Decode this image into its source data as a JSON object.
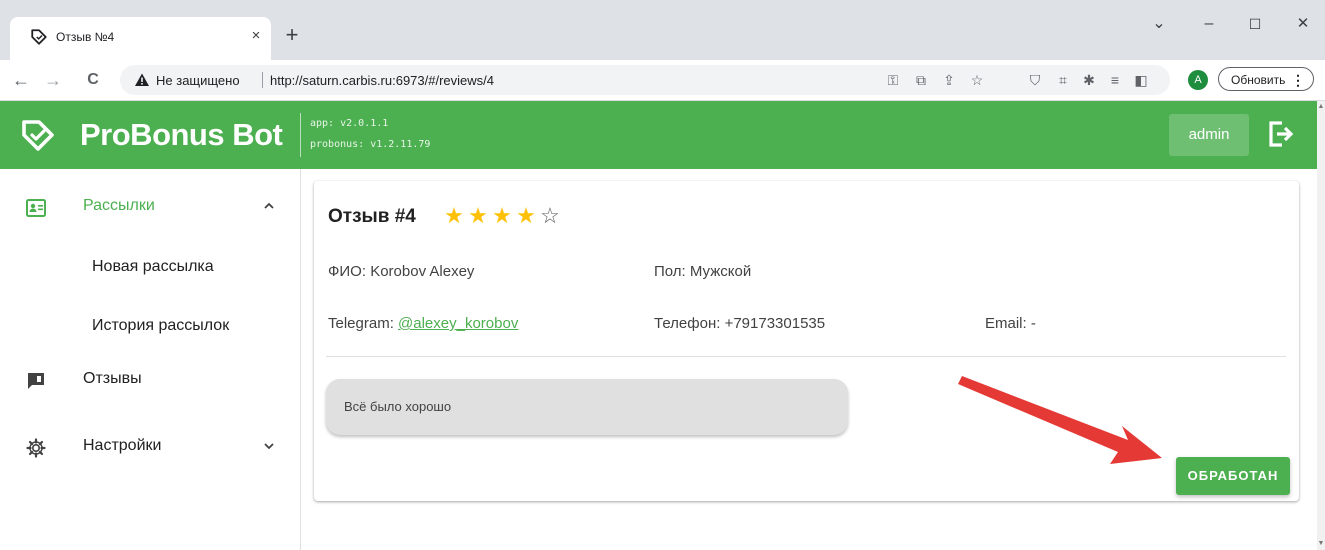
{
  "browser": {
    "tab_title": "Отзыв №4",
    "tab_close": "×",
    "new_tab": "+",
    "window": {
      "minimize": "–",
      "maximize": "☐",
      "close": "✕",
      "dropdown": "⌄"
    },
    "nav": {
      "back": "←",
      "forward": "→",
      "reload": "C"
    },
    "security_label": "Не защищено",
    "url": "http://saturn.carbis.ru:6973/#/reviews/4",
    "update_label": "Обновить",
    "profile_initial": "A"
  },
  "app": {
    "brand": "ProBonus Bot",
    "version_app": "app: v2.0.1.1",
    "version_probonus": "probonus: v1.2.11.79",
    "user": "admin"
  },
  "sidebar": {
    "items": [
      {
        "label": "Рассылки",
        "icon": "contact-card-icon",
        "expanded": true
      },
      {
        "label": "Новая рассылка"
      },
      {
        "label": "История рассылок"
      },
      {
        "label": "Отзывы",
        "icon": "feedback-icon"
      },
      {
        "label": "Настройки",
        "icon": "gear-icon",
        "expanded": false
      }
    ]
  },
  "review": {
    "title": "Отзыв #4",
    "rating": 4,
    "max_rating": 5,
    "fio_label": "ФИО:",
    "fio": "Korobov Alexey",
    "gender_label": "Пол:",
    "gender": "Мужской",
    "telegram_label": "Telegram:",
    "telegram": "@alexey_korobov",
    "phone_label": "Телефон:",
    "phone": "+79173301535",
    "email_label": "Email:",
    "email": "-",
    "message": "Всё было хорошо",
    "action_label": "ОБРАБОТАН"
  },
  "colors": {
    "primary": "#4caf50",
    "star": "#ffc107",
    "annotation_arrow": "#e53935"
  }
}
